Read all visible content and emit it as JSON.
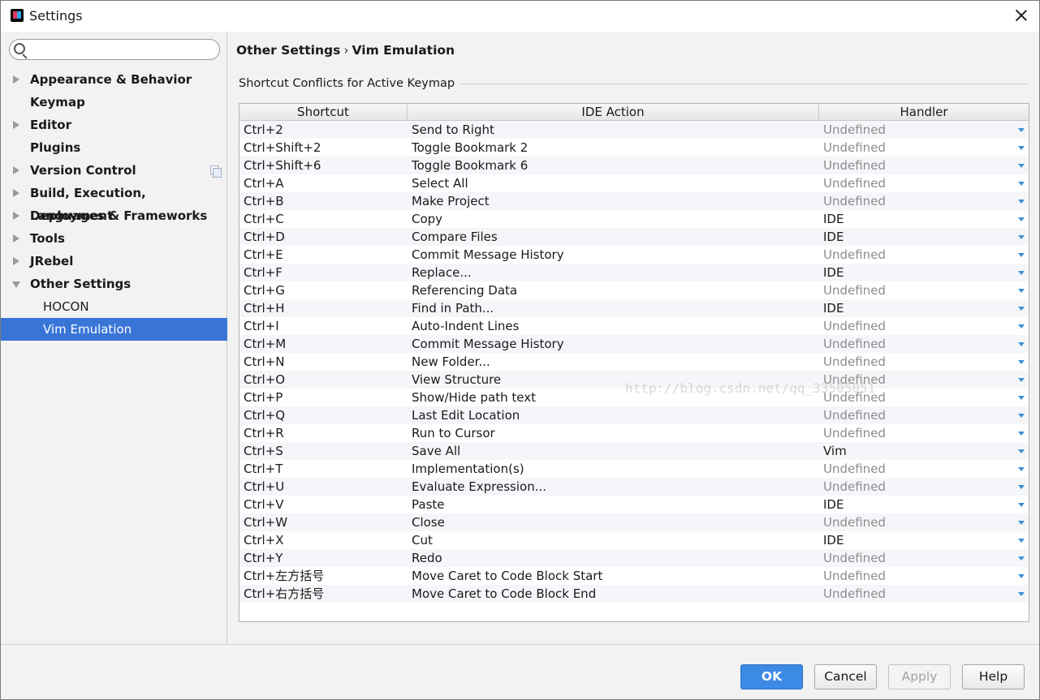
{
  "window": {
    "title": "Settings"
  },
  "sidebar": {
    "search": {
      "value": "",
      "placeholder": ""
    },
    "items": [
      {
        "label": "Appearance & Behavior",
        "expandable": true,
        "expanded": false,
        "bold": true
      },
      {
        "label": "Keymap",
        "expandable": false,
        "bold": true
      },
      {
        "label": "Editor",
        "expandable": true,
        "expanded": false,
        "bold": true
      },
      {
        "label": "Plugins",
        "expandable": false,
        "bold": true
      },
      {
        "label": "Version Control",
        "expandable": true,
        "expanded": false,
        "bold": true,
        "project_icon": "copy-icon"
      },
      {
        "label": "Build, Execution, Deployment",
        "expandable": true,
        "expanded": false,
        "bold": true
      },
      {
        "label": "Languages & Frameworks",
        "expandable": true,
        "expanded": false,
        "bold": true
      },
      {
        "label": "Tools",
        "expandable": true,
        "expanded": false,
        "bold": true
      },
      {
        "label": "JRebel",
        "expandable": true,
        "expanded": false,
        "bold": true
      },
      {
        "label": "Other Settings",
        "expandable": true,
        "expanded": true,
        "bold": true
      },
      {
        "label": "HOCON",
        "child": true
      },
      {
        "label": "Vim Emulation",
        "child": true,
        "selected": true
      }
    ]
  },
  "main": {
    "breadcrumb": {
      "parent": "Other Settings",
      "separator": "›",
      "current": "Vim Emulation"
    },
    "group_title": "Shortcut Conflicts for Active Keymap",
    "table": {
      "headers": {
        "shortcut": "Shortcut",
        "action": "IDE Action",
        "handler": "Handler"
      },
      "rows": [
        {
          "shortcut": "Ctrl+2",
          "action": "Send to Right",
          "handler": "Undefined"
        },
        {
          "shortcut": "Ctrl+Shift+2",
          "action": "Toggle Bookmark 2",
          "handler": "Undefined"
        },
        {
          "shortcut": "Ctrl+Shift+6",
          "action": "Toggle Bookmark 6",
          "handler": "Undefined"
        },
        {
          "shortcut": "Ctrl+A",
          "action": "Select All",
          "handler": "Undefined"
        },
        {
          "shortcut": "Ctrl+B",
          "action": "Make Project",
          "handler": "Undefined"
        },
        {
          "shortcut": "Ctrl+C",
          "action": "Copy",
          "handler": "IDE"
        },
        {
          "shortcut": "Ctrl+D",
          "action": "Compare Files",
          "handler": "IDE"
        },
        {
          "shortcut": "Ctrl+E",
          "action": "Commit Message History",
          "handler": "Undefined"
        },
        {
          "shortcut": "Ctrl+F",
          "action": "Replace...",
          "handler": "IDE"
        },
        {
          "shortcut": "Ctrl+G",
          "action": "Referencing Data",
          "handler": "Undefined"
        },
        {
          "shortcut": "Ctrl+H",
          "action": "Find in Path...",
          "handler": "IDE"
        },
        {
          "shortcut": "Ctrl+I",
          "action": "Auto-Indent Lines",
          "handler": "Undefined"
        },
        {
          "shortcut": "Ctrl+M",
          "action": "Commit Message History",
          "handler": "Undefined"
        },
        {
          "shortcut": "Ctrl+N",
          "action": "New Folder...",
          "handler": "Undefined"
        },
        {
          "shortcut": "Ctrl+O",
          "action": "View Structure",
          "handler": "Undefined"
        },
        {
          "shortcut": "Ctrl+P",
          "action": "Show/Hide path text",
          "handler": "Undefined"
        },
        {
          "shortcut": "Ctrl+Q",
          "action": "Last Edit Location",
          "handler": "Undefined"
        },
        {
          "shortcut": "Ctrl+R",
          "action": "Run to Cursor",
          "handler": "Undefined"
        },
        {
          "shortcut": "Ctrl+S",
          "action": "Save All",
          "handler": "Vim"
        },
        {
          "shortcut": "Ctrl+T",
          "action": "Implementation(s)",
          "handler": "Undefined"
        },
        {
          "shortcut": "Ctrl+U",
          "action": "Evaluate Expression...",
          "handler": "Undefined"
        },
        {
          "shortcut": "Ctrl+V",
          "action": "Paste",
          "handler": "IDE"
        },
        {
          "shortcut": "Ctrl+W",
          "action": "Close",
          "handler": "Undefined"
        },
        {
          "shortcut": "Ctrl+X",
          "action": "Cut",
          "handler": "IDE"
        },
        {
          "shortcut": "Ctrl+Y",
          "action": "Redo",
          "handler": "Undefined"
        },
        {
          "shortcut": "Ctrl+左方括号",
          "action": "Move Caret to Code Block Start",
          "handler": "Undefined"
        },
        {
          "shortcut": "Ctrl+右方括号",
          "action": "Move Caret to Code Block End",
          "handler": "Undefined"
        }
      ]
    }
  },
  "watermark": "http://blog.csdn.net/qq_33505051",
  "footer": {
    "ok_label": "OK",
    "cancel_label": "Cancel",
    "apply_label": "Apply",
    "help_label": "Help"
  },
  "colors": {
    "selection": "#3875d7",
    "ok_button": "#3c8ae6",
    "dropdown_arrow": "#3c8fd6",
    "undefined_text": "#8c8c8c"
  }
}
